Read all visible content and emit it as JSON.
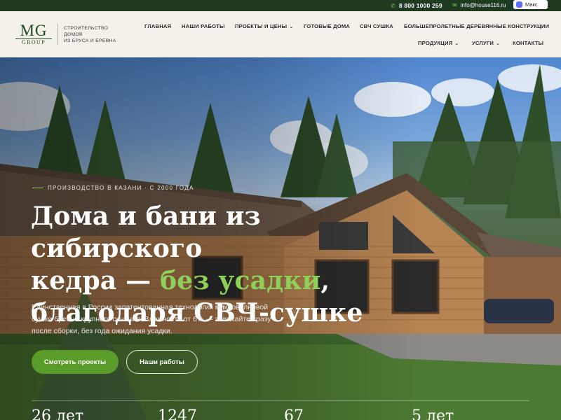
{
  "topbar": {
    "phone": "8 800 1000 259",
    "email": "info@house116.ru",
    "messenger_label": "Макс",
    "phone_icon": "phone-icon",
    "email_icon": "mail-icon"
  },
  "logo": {
    "mark": "MG",
    "sub": "GROUP"
  },
  "tagline": [
    "СТРОИТЕЛЬСТВО",
    "ДОМОВ",
    "ИЗ БРУСА И БРЕВНА"
  ],
  "nav": {
    "home": "ГЛАВНАЯ",
    "works": "НАШИ РАБОТЫ",
    "projects": "ПРОЕКТЫ И ЦЕНЫ",
    "ready": "ГОТОВЫЕ ДОМА",
    "microwave": "СВЧ СУШКА",
    "large_span": "БОЛЬШЕПРОЛЕТНЫЕ ДЕРЕВЯННЫЕ КОНСТРУКЦИИ",
    "products": "ПРОДУКЦИЯ",
    "services": "УСЛУГИ",
    "contacts": "КОНТАКТЫ"
  },
  "hero": {
    "eyebrow": "ПРОИЗВОДСТВО В КАЗАНИ · С 2000 ГОДА",
    "headline_line1": "Дома и бани из сибирского",
    "headline_line2_prefix": "кедра — ",
    "headline_accent": "без усадки",
    "headline_line2_suffix": ",",
    "headline_line3": "благодаря СВЧ-сушке",
    "description": "Единственная в России запатентованная технология микроволновой сушки бревна крупного сечения. Влажность от 6% — заезжайте сразу после сборки, без года ожидания усадки.",
    "primary_button": "Смотреть проекты",
    "secondary_button": "Наши работы"
  },
  "stats": [
    "26 лет",
    "1247",
    "67",
    "5 лет"
  ],
  "colors": {
    "topbar_bg": "#1e3a21",
    "accent_green": "#8ed05a",
    "button_green": "#5a9c2a",
    "header_bg": "#f4f1ea",
    "logo_green": "#1f4d25"
  }
}
